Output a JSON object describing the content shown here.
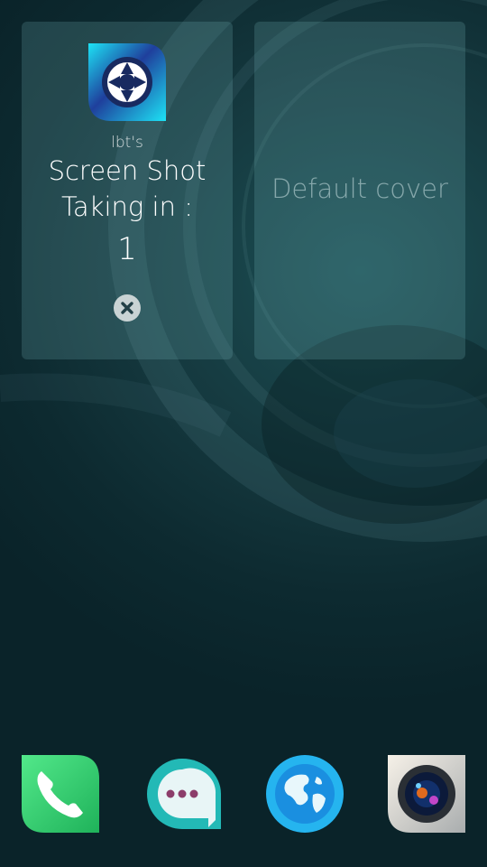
{
  "covers": {
    "screenshot": {
      "app_icon": "camera-shutter-icon",
      "author": "lbt's",
      "title": "Screen Shot",
      "status": "Taking in :",
      "countdown": "1",
      "close_icon": "close-icon"
    },
    "default": {
      "label": "Default cover"
    }
  },
  "dock": {
    "items": [
      {
        "app": "phone",
        "icon": "phone-icon",
        "color": "#2fd36b"
      },
      {
        "app": "messages",
        "icon": "chat-bubble-icon",
        "color": "#2ec7c3"
      },
      {
        "app": "browser",
        "icon": "globe-icon",
        "color": "#1aa2ee"
      },
      {
        "app": "camera",
        "icon": "camera-icon",
        "color": "#9aa0a2"
      }
    ]
  },
  "colors": {
    "background": "#0d2a30",
    "cover_fill": "rgba(120,180,185,0.22)",
    "accent": "#19d6f2"
  }
}
